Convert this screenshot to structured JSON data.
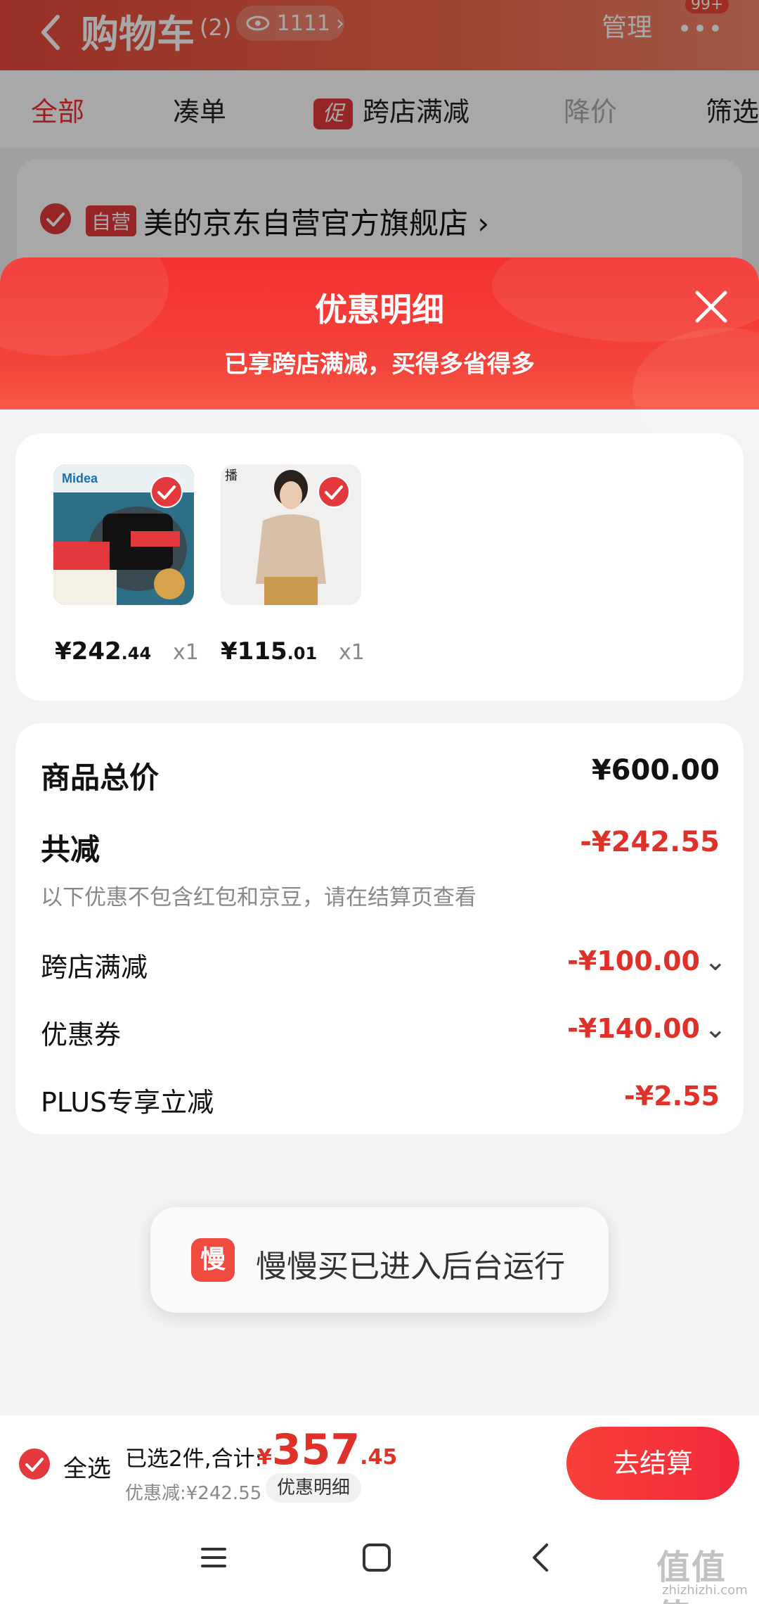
{
  "cart": {
    "title": "购物车",
    "count": "(2)",
    "views": "1111",
    "manage": "管理",
    "badge": "99+",
    "tabs": [
      {
        "label": "全部",
        "state": "active"
      },
      {
        "label": "凑单",
        "state": "normal"
      },
      {
        "label": "跨店满减",
        "promo_tag": "促",
        "state": "normal"
      },
      {
        "label": "降价",
        "state": "muted"
      },
      {
        "label": "筛选",
        "state": "normal"
      }
    ],
    "store": {
      "tag": "自营",
      "name": "美的京东自营官方旗舰店 ›"
    }
  },
  "sheet": {
    "title": "优惠明细",
    "subtitle": "已享跨店满减，买得多省得多",
    "products": [
      {
        "price_int": "¥242",
        "price_dec": ".44",
        "qty": "x1",
        "image": "midea-pressure-cooker"
      },
      {
        "price_int": "¥115",
        "price_dec": ".01",
        "qty": "x1",
        "image": "woman-lace-top",
        "tag": "播"
      }
    ],
    "breakdown": {
      "total_label": "商品总价",
      "total_value": "¥600.00",
      "reduce_label": "共减",
      "reduce_value": "-¥242.55",
      "note": "以下优惠不包含红包和京豆，请在结算页查看",
      "items": [
        {
          "label": "跨店满减",
          "value": "-¥100.00",
          "expandable": true
        },
        {
          "label": "优惠券",
          "value": "-¥140.00",
          "expandable": true
        },
        {
          "label": "PLUS专享立减",
          "value": "-¥2.55",
          "expandable": false
        }
      ]
    }
  },
  "toast": {
    "icon_text": "慢",
    "text": "慢慢买已进入后台运行"
  },
  "checkout": {
    "select_all": "全选",
    "selected_text": "已选2件,合计:",
    "total_currency": "¥",
    "total_int": "357",
    "total_dec": ".45",
    "discount_text": "优惠减:¥242.55",
    "detail_pill": "优惠明细",
    "pay_button": "去结算"
  },
  "watermark": {
    "main": "值值值",
    "sub": "zhizhizhi.com"
  },
  "colors": {
    "accent": "#e4393c",
    "price_red": "#e03128",
    "header_red": "#f3322f"
  }
}
